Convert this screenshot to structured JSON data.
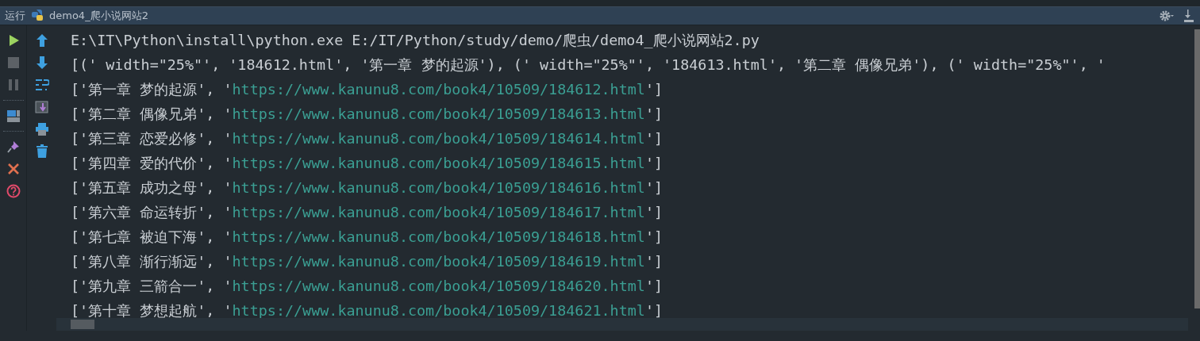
{
  "run_panel": {
    "label": "运行",
    "config_name": "demo4_爬小说网站2"
  },
  "console": {
    "lines": [
      {
        "segments": [
          {
            "kind": "plain",
            "text": "E:\\IT\\Python\\install\\python.exe E:/IT/Python/study/demo/爬虫/demo4_爬小说网站2.py"
          }
        ]
      },
      {
        "segments": [
          {
            "kind": "plain",
            "text": "[(' width=\"25%\"', '184612.html', '第一章 梦的起源'), (' width=\"25%\"', '184613.html', '第二章 偶像兄弟'), (' width=\"25%\"', '"
          }
        ]
      },
      {
        "segments": [
          {
            "kind": "plain",
            "text": "['第一章 梦的起源', '"
          },
          {
            "kind": "link",
            "text": "https://www.kanunu8.com/book4/10509/184612.html"
          },
          {
            "kind": "plain",
            "text": "']"
          }
        ]
      },
      {
        "segments": [
          {
            "kind": "plain",
            "text": "['第二章 偶像兄弟', '"
          },
          {
            "kind": "link",
            "text": "https://www.kanunu8.com/book4/10509/184613.html"
          },
          {
            "kind": "plain",
            "text": "']"
          }
        ]
      },
      {
        "segments": [
          {
            "kind": "plain",
            "text": "['第三章 恋爱必修', '"
          },
          {
            "kind": "link",
            "text": "https://www.kanunu8.com/book4/10509/184614.html"
          },
          {
            "kind": "plain",
            "text": "']"
          }
        ]
      },
      {
        "segments": [
          {
            "kind": "plain",
            "text": "['第四章 爱的代价', '"
          },
          {
            "kind": "link",
            "text": "https://www.kanunu8.com/book4/10509/184615.html"
          },
          {
            "kind": "plain",
            "text": "']"
          }
        ]
      },
      {
        "segments": [
          {
            "kind": "plain",
            "text": "['第五章 成功之母', '"
          },
          {
            "kind": "link",
            "text": "https://www.kanunu8.com/book4/10509/184616.html"
          },
          {
            "kind": "plain",
            "text": "']"
          }
        ]
      },
      {
        "segments": [
          {
            "kind": "plain",
            "text": "['第六章 命运转折', '"
          },
          {
            "kind": "link",
            "text": "https://www.kanunu8.com/book4/10509/184617.html"
          },
          {
            "kind": "plain",
            "text": "']"
          }
        ]
      },
      {
        "segments": [
          {
            "kind": "plain",
            "text": "['第七章 被迫下海', '"
          },
          {
            "kind": "link",
            "text": "https://www.kanunu8.com/book4/10509/184618.html"
          },
          {
            "kind": "plain",
            "text": "']"
          }
        ]
      },
      {
        "segments": [
          {
            "kind": "plain",
            "text": "['第八章 渐行渐远', '"
          },
          {
            "kind": "link",
            "text": "https://www.kanunu8.com/book4/10509/184619.html"
          },
          {
            "kind": "plain",
            "text": "']"
          }
        ]
      },
      {
        "segments": [
          {
            "kind": "plain",
            "text": "['第九章 三箭合一', '"
          },
          {
            "kind": "link",
            "text": "https://www.kanunu8.com/book4/10509/184620.html"
          },
          {
            "kind": "plain",
            "text": "']"
          }
        ]
      },
      {
        "segments": [
          {
            "kind": "plain",
            "text": "['第十章 梦想起航', '"
          },
          {
            "kind": "link",
            "text": "https://www.kanunu8.com/book4/10509/184621.html"
          },
          {
            "kind": "plain",
            "text": "']"
          }
        ]
      }
    ]
  }
}
